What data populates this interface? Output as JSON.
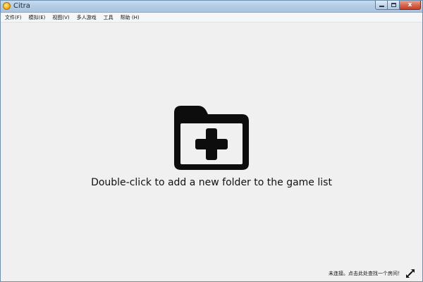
{
  "window": {
    "title": "Citra",
    "minimize_glyph": "",
    "close_glyph": "x"
  },
  "menu": [
    {
      "label": "文件(F)"
    },
    {
      "label": "模拟(E)"
    },
    {
      "label": "视图(V)"
    },
    {
      "label": "多人游戏"
    },
    {
      "label": "工具"
    },
    {
      "label": "帮助 (H)"
    }
  ],
  "game_list": {
    "icon": "add-folder-icon",
    "placeholder_text": "Double-click to add a new folder to the game list"
  },
  "status": {
    "network_text": "未连接。点击此处查找一个房间！",
    "network_icon": "network-disconnected-icon"
  },
  "colors": {
    "titlebar": "#b4cde6",
    "close_button": "#d7694f",
    "background": "#f0f0f0",
    "icon": "#0d0d0d"
  }
}
